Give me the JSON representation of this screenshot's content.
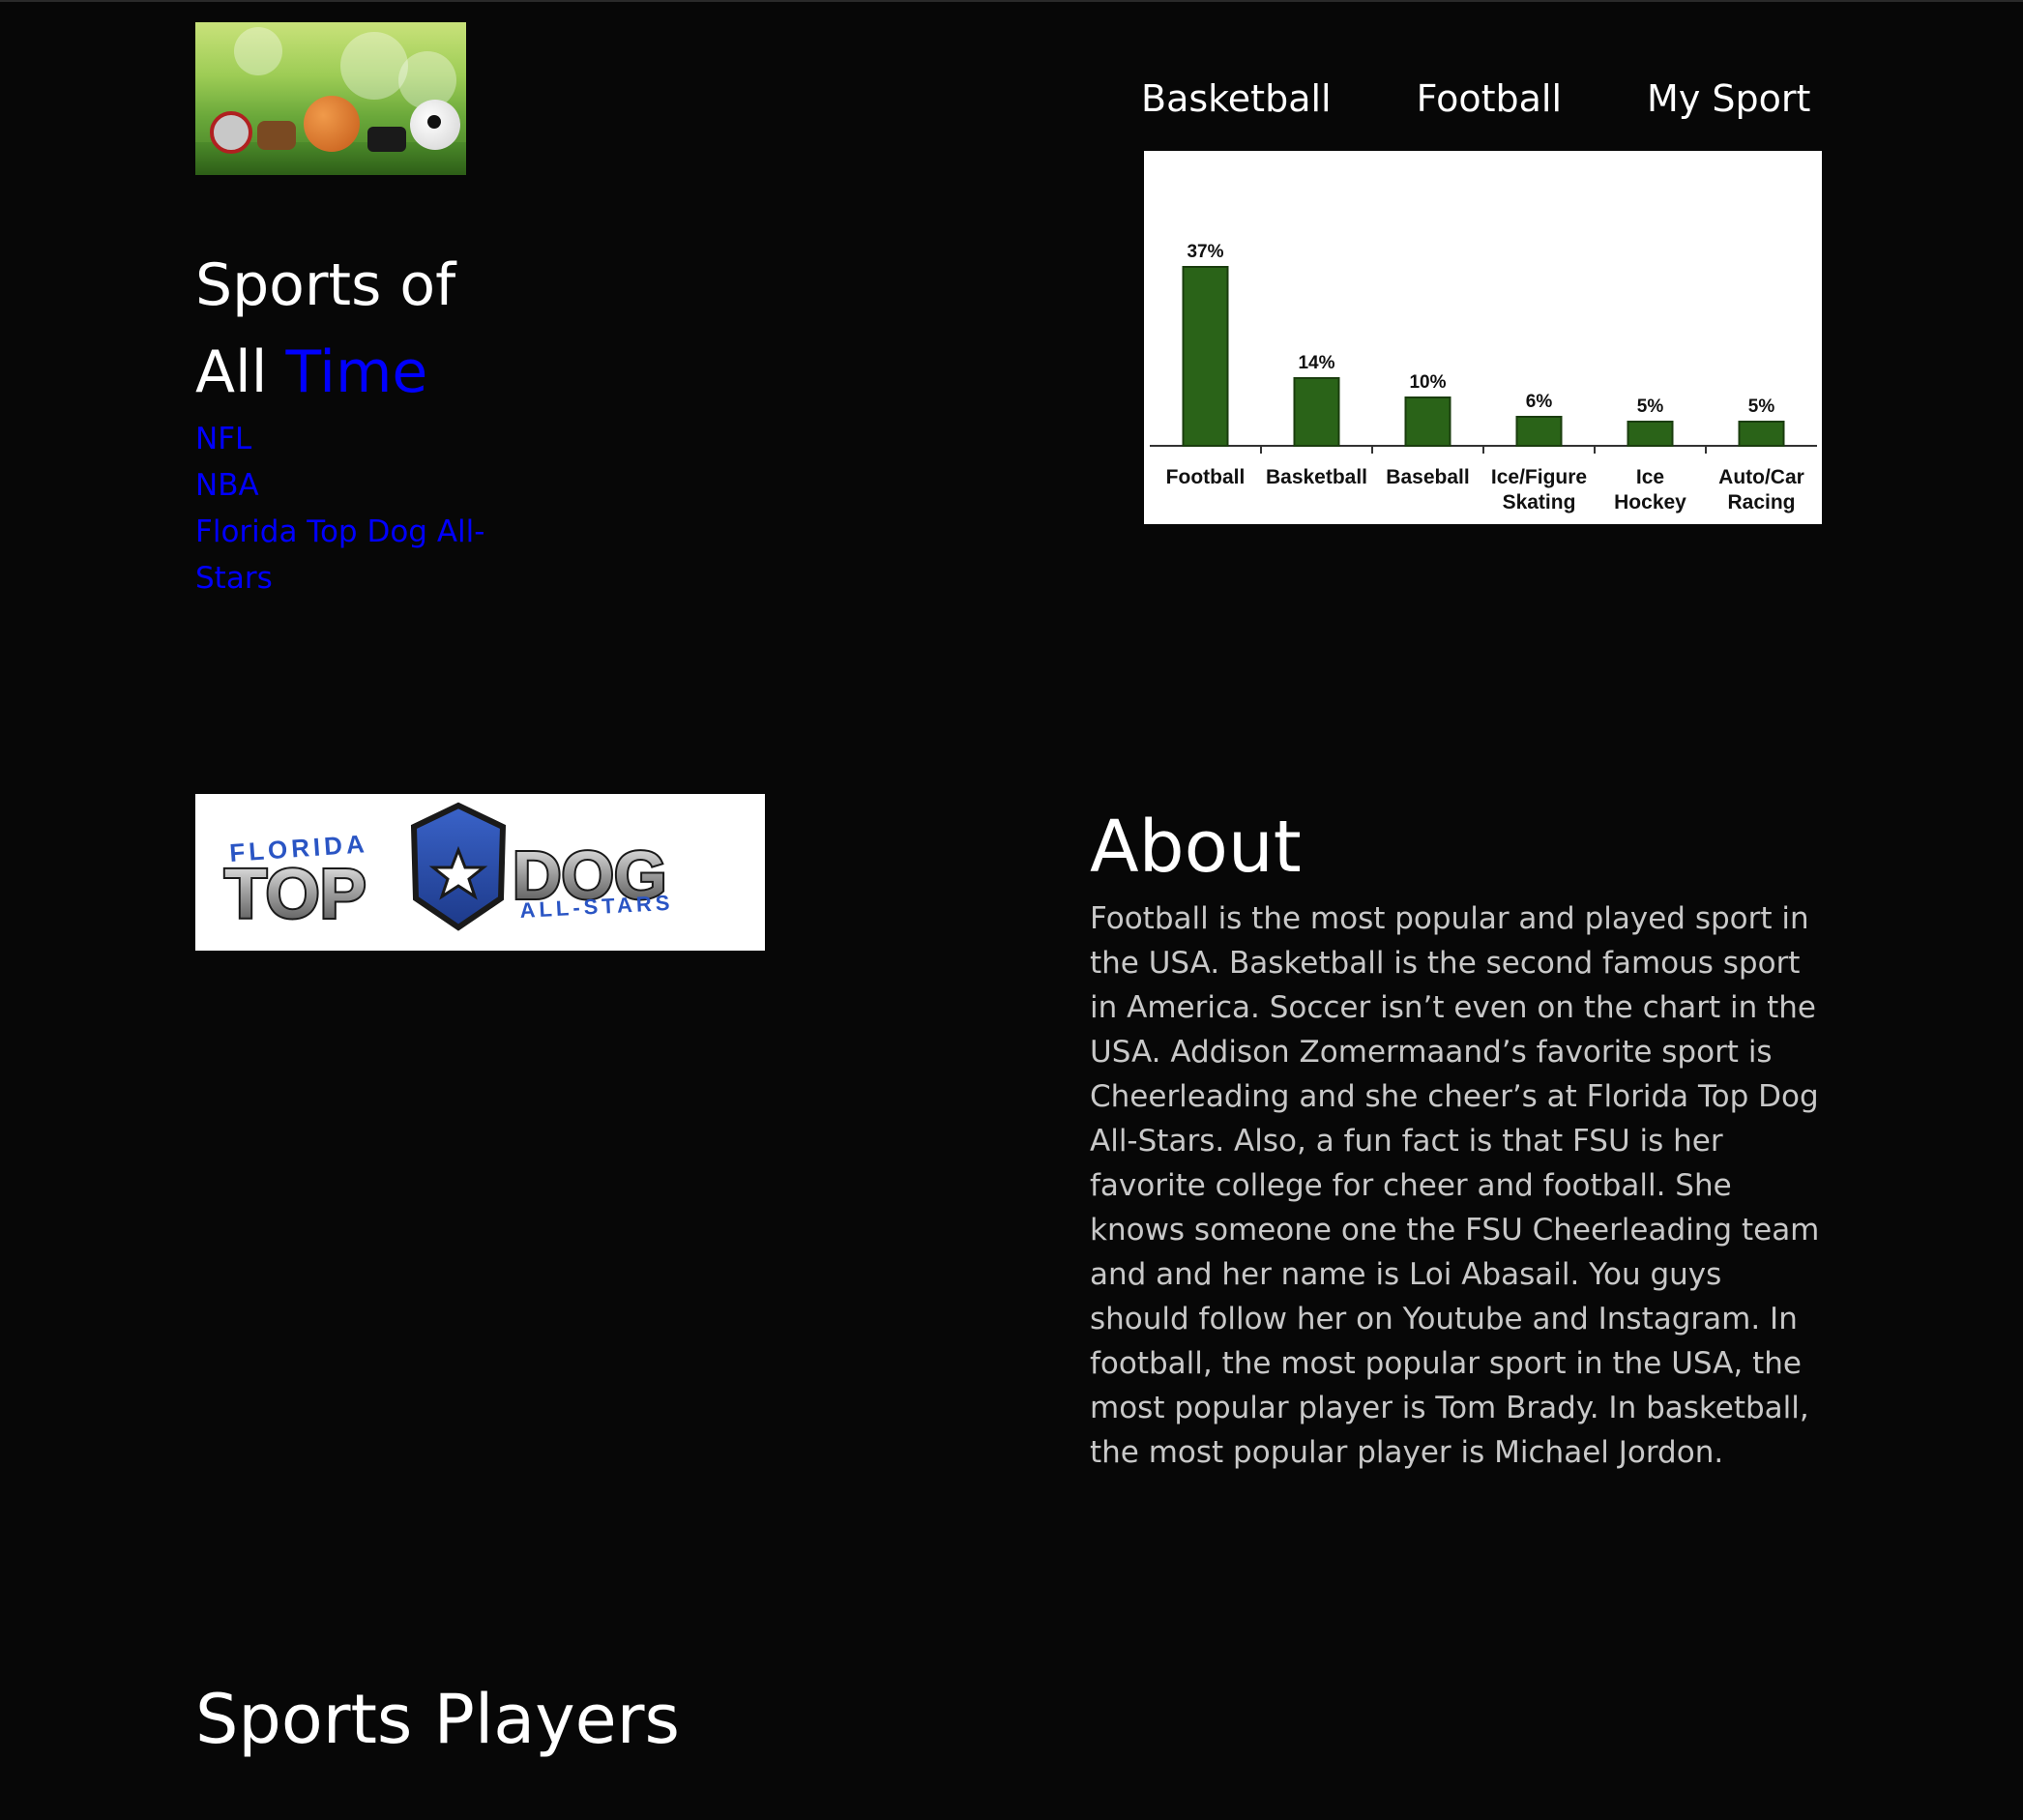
{
  "nav": {
    "items": [
      "Basketball",
      "Football",
      "My Sport"
    ]
  },
  "hero": {
    "title_part1": "Sports of",
    "title_part2": "All",
    "title_accent": "Time",
    "accent_color": "#0000ff"
  },
  "side_links": [
    "NFL",
    "NBA",
    "Florida Top Dog All-Stars"
  ],
  "logo": {
    "top_text": "FLORIDA",
    "left_word": "TOP",
    "right_word": "DOG",
    "tagline": "ALL-STARS"
  },
  "about": {
    "heading": "About",
    "body": "Football is the most popular and played sport in the USA. Basketball is the second famous sport in America. Soccer isn’t even on the chart in the USA. Addison Zomermaand’s favorite sport is Cheerleading and she cheer’s at Florida Top Dog All-Stars. Also, a fun fact is that FSU is her favorite college for cheer and football. She knows someone one the FSU Cheerleading team and and her name is Loi Abasail. You guys should follow her on Youtube and Instagram. In football, the most popular sport in the USA, the most popular player is Tom Brady. In basketball, the most popular player is Michael Jordon."
  },
  "players": {
    "heading": "Sports Players"
  },
  "chart_data": {
    "type": "bar",
    "categories": [
      "Football",
      "Basketball",
      "Baseball",
      "Ice/Figure Skating",
      "Ice Hockey",
      "Auto/Car Racing"
    ],
    "category_lines": [
      [
        "Football"
      ],
      [
        "Basketball"
      ],
      [
        "Baseball"
      ],
      [
        "Ice/Figure",
        "Skating"
      ],
      [
        "Ice",
        "Hockey"
      ],
      [
        "Auto/Car",
        "Racing"
      ]
    ],
    "values": [
      37,
      14,
      10,
      6,
      5,
      5
    ],
    "value_labels": [
      "37%",
      "14%",
      "10%",
      "6%",
      "5%",
      "5%"
    ],
    "bar_color": "#2a6318",
    "ylim": [
      0,
      40
    ],
    "grid": false,
    "title": "",
    "xlabel": "",
    "ylabel": ""
  }
}
